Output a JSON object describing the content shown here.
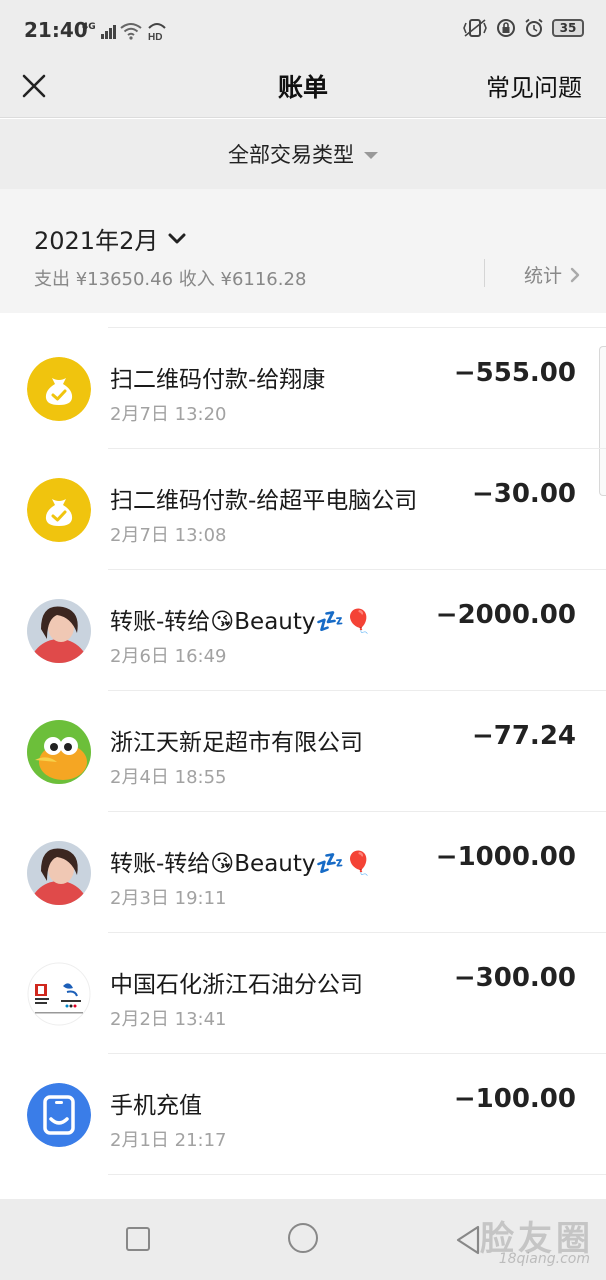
{
  "status_bar": {
    "time": "21:40",
    "network": "4G",
    "battery": "35"
  },
  "header": {
    "title": "账单",
    "faq": "常见问题"
  },
  "filter": {
    "label": "全部交易类型"
  },
  "month": {
    "label": "2021年2月",
    "summary": "支出 ¥13650.46 收入 ¥6116.28",
    "stats_label": "统计"
  },
  "transactions": [
    {
      "title": "扫二维码付款-给翔康",
      "date": "2月7日 13:20",
      "amount": "−555.00",
      "icon": "money-bag-icon"
    },
    {
      "title": "扫二维码付款-给超平电脑公司",
      "date": "2月7日 13:08",
      "amount": "−30.00",
      "icon": "money-bag-icon"
    },
    {
      "title": "转账-转给😘Beauty💤🎈",
      "date": "2月6日 16:49",
      "amount": "−2000.00",
      "icon": "user-avatar"
    },
    {
      "title": "浙江天新足超市有限公司",
      "date": "2月4日 18:55",
      "amount": "−77.24",
      "icon": "duck-avatar"
    },
    {
      "title": "转账-转给😘Beauty💤🎈",
      "date": "2月3日 19:11",
      "amount": "−1000.00",
      "icon": "user-avatar"
    },
    {
      "title": "中国石化浙江石油分公司",
      "date": "2月2日 13:41",
      "amount": "−300.00",
      "icon": "sinopec-logo"
    },
    {
      "title": "手机充值",
      "date": "2月1日 21:17",
      "amount": "−100.00",
      "icon": "phone-recharge-icon"
    }
  ],
  "watermark": {
    "text": "脸友圈",
    "sub": "18qiang.com"
  },
  "colors": {
    "gold": "#f0c40e",
    "background_gray": "#ededed"
  }
}
